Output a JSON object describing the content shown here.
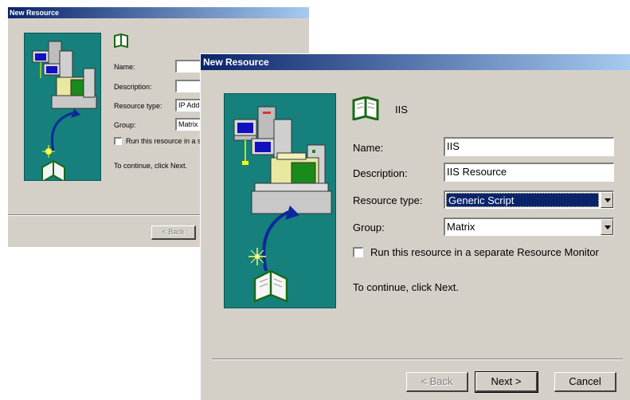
{
  "back_window": {
    "title": "New Resource",
    "resource_name": "",
    "labels": {
      "name": "Name:",
      "description": "Description:",
      "resource_type": "Resource type:",
      "group": "Group:"
    },
    "fields": {
      "name": "",
      "description": "",
      "resource_type": "IP Add",
      "group": "Matrix"
    },
    "checkbox_label": "Run this resource in a se",
    "continue_text": "To continue, click Next.",
    "buttons": {
      "back": "< Back"
    }
  },
  "front_window": {
    "title": "New Resource",
    "resource_name": "IIS",
    "labels": {
      "name": "Name:",
      "description": "Description:",
      "resource_type": "Resource type:",
      "group": "Group:"
    },
    "fields": {
      "name": "IIS",
      "description": "IIS Resource",
      "resource_type": "Generic Script",
      "group": "Matrix"
    },
    "checkbox_label": "Run this resource in a separate Resource Monitor",
    "checkbox_checked": false,
    "continue_text": "To continue, click Next.",
    "buttons": {
      "back": "< Back",
      "next": "Next >",
      "cancel": "Cancel"
    }
  },
  "colors": {
    "titlebar_start": "#0a246a",
    "titlebar_end": "#a6caf0",
    "dialog_bg": "#d4d0c8",
    "wizard_panel": "#15807c",
    "selection": "#0a246a"
  },
  "icons": {
    "wizard_illustration": "server-folder-book-illustration",
    "resource_icon": "open-book-icon"
  }
}
